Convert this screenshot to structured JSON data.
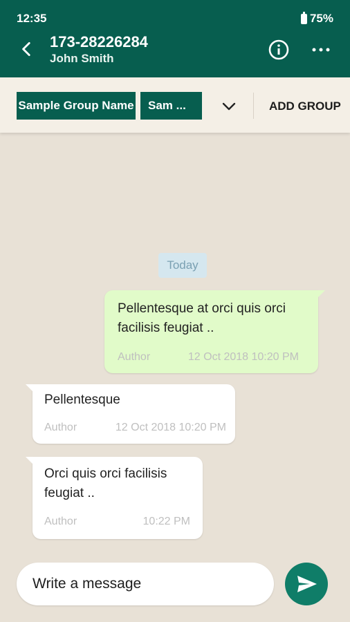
{
  "status_bar": {
    "time": "12:35",
    "battery": "75%"
  },
  "header": {
    "title": "173-28226284",
    "subtitle": "John Smith"
  },
  "group_bar": {
    "chips": [
      "Sample Group Name",
      "Sam ..."
    ],
    "add_group_label": "ADD GROUP"
  },
  "chat": {
    "date_separator": "Today",
    "messages": [
      {
        "direction": "outgoing",
        "text": "Pellentesque at orci quis orci facilisis feugiat ..",
        "author": "Author",
        "timestamp": "12 Oct 2018  10:20 PM"
      },
      {
        "direction": "incoming",
        "text": "Pellentesque",
        "author": "Author",
        "timestamp": "12 Oct 2018  10:20 PM"
      },
      {
        "direction": "incoming",
        "text": "Orci quis orci facilisis feugiat ..",
        "author": "Author",
        "timestamp": "10:22 PM"
      }
    ]
  },
  "composer": {
    "placeholder": "Write a message"
  },
  "icons": {
    "back": "back-arrow-icon",
    "info": "info-icon",
    "more": "more-icon",
    "dropdown": "chevron-down-icon",
    "send": "send-icon",
    "battery": "battery-icon"
  },
  "colors": {
    "primary": "#075e4f",
    "chat_background": "#e8e1d6",
    "outgoing_bubble": "#e1fbc9",
    "incoming_bubble": "#ffffff",
    "send_button": "#0f7d68",
    "date_badge": "#d5e7ef"
  }
}
